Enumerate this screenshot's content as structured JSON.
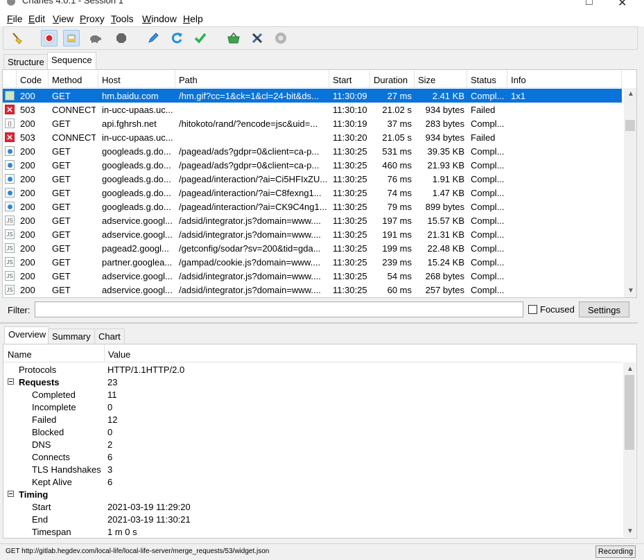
{
  "window": {
    "title": "Charles 4.0.1 - Session 1"
  },
  "menu": [
    {
      "key": "F",
      "rest": "ile"
    },
    {
      "key": "E",
      "rest": "dit"
    },
    {
      "key": "V",
      "rest": "iew"
    },
    {
      "key": "P",
      "rest": "roxy"
    },
    {
      "key": "T",
      "rest": "ools"
    },
    {
      "key": "W",
      "rest": "indow"
    },
    {
      "key": "H",
      "rest": "elp"
    }
  ],
  "toolbar_icons": [
    "broom-icon",
    "record-icon",
    "throttle-icon",
    "turtle-icon",
    "stop-icon",
    "pen-icon",
    "refresh-icon",
    "check-icon",
    "basket-icon",
    "tools-icon",
    "gear-icon"
  ],
  "view_tabs": [
    "Structure",
    "Sequence"
  ],
  "columns": [
    "Code",
    "Method",
    "Host",
    "Path",
    "Start",
    "Duration",
    "Size",
    "Status",
    "Info"
  ],
  "rows": [
    {
      "icon": "image",
      "code": "200",
      "method": "GET",
      "host": "hm.baidu.com",
      "path": "/hm.gif?cc=1&ck=1&cl=24-bit&ds...",
      "start": "11:30:09",
      "duration": "27 ms",
      "size": "2.41 KB",
      "status": "Compl...",
      "info": "1x1",
      "selected": true
    },
    {
      "icon": "error",
      "code": "503",
      "method": "CONNECT",
      "host": "in-ucc-upaas.uc...",
      "path": "",
      "start": "11:30:10",
      "duration": "21.02 s",
      "size": "934 bytes",
      "status": "Failed",
      "info": ""
    },
    {
      "icon": "file",
      "code": "200",
      "method": "GET",
      "host": "api.fghrsh.net",
      "path": "/hitokoto/rand/?encode=jsc&uid=...",
      "start": "11:30:19",
      "duration": "37 ms",
      "size": "283 bytes",
      "status": "Compl...",
      "info": ""
    },
    {
      "icon": "error",
      "code": "503",
      "method": "CONNECT",
      "host": "in-ucc-upaas.uc...",
      "path": "",
      "start": "11:30:20",
      "duration": "21.05 s",
      "size": "934 bytes",
      "status": "Failed",
      "info": ""
    },
    {
      "icon": "dot",
      "code": "200",
      "method": "GET",
      "host": "googleads.g.do...",
      "path": "/pagead/ads?gdpr=0&client=ca-p...",
      "start": "11:30:25",
      "duration": "531 ms",
      "size": "39.35 KB",
      "status": "Compl...",
      "info": ""
    },
    {
      "icon": "dot",
      "code": "200",
      "method": "GET",
      "host": "googleads.g.do...",
      "path": "/pagead/ads?gdpr=0&client=ca-p...",
      "start": "11:30:25",
      "duration": "460 ms",
      "size": "21.93 KB",
      "status": "Compl...",
      "info": ""
    },
    {
      "icon": "dot",
      "code": "200",
      "method": "GET",
      "host": "googleads.g.do...",
      "path": "/pagead/interaction/?ai=Ci5HFIxZU...",
      "start": "11:30:25",
      "duration": "76 ms",
      "size": "1.91 KB",
      "status": "Compl...",
      "info": ""
    },
    {
      "icon": "dot",
      "code": "200",
      "method": "GET",
      "host": "googleads.g.do...",
      "path": "/pagead/interaction/?ai=C8fexng1...",
      "start": "11:30:25",
      "duration": "74 ms",
      "size": "1.47 KB",
      "status": "Compl...",
      "info": ""
    },
    {
      "icon": "dot",
      "code": "200",
      "method": "GET",
      "host": "googleads.g.do...",
      "path": "/pagead/interaction/?ai=CK9C4ng1...",
      "start": "11:30:25",
      "duration": "79 ms",
      "size": "899 bytes",
      "status": "Compl...",
      "info": ""
    },
    {
      "icon": "js",
      "code": "200",
      "method": "GET",
      "host": "adservice.googl...",
      "path": "/adsid/integrator.js?domain=www....",
      "start": "11:30:25",
      "duration": "197 ms",
      "size": "15.57 KB",
      "status": "Compl...",
      "info": ""
    },
    {
      "icon": "js",
      "code": "200",
      "method": "GET",
      "host": "adservice.googl...",
      "path": "/adsid/integrator.js?domain=www....",
      "start": "11:30:25",
      "duration": "191 ms",
      "size": "21.31 KB",
      "status": "Compl...",
      "info": ""
    },
    {
      "icon": "js",
      "code": "200",
      "method": "GET",
      "host": "pagead2.googl...",
      "path": "/getconfig/sodar?sv=200&tid=gda...",
      "start": "11:30:25",
      "duration": "199 ms",
      "size": "22.48 KB",
      "status": "Compl...",
      "info": ""
    },
    {
      "icon": "js",
      "code": "200",
      "method": "GET",
      "host": "partner.googlea...",
      "path": "/gampad/cookie.js?domain=www....",
      "start": "11:30:25",
      "duration": "239 ms",
      "size": "15.24 KB",
      "status": "Compl...",
      "info": ""
    },
    {
      "icon": "js",
      "code": "200",
      "method": "GET",
      "host": "adservice.googl...",
      "path": "/adsid/integrator.js?domain=www....",
      "start": "11:30:25",
      "duration": "54 ms",
      "size": "268 bytes",
      "status": "Compl...",
      "info": ""
    },
    {
      "icon": "js",
      "code": "200",
      "method": "GET",
      "host": "adservice.googl...",
      "path": "/adsid/integrator.js?domain=www....",
      "start": "11:30:25",
      "duration": "60 ms",
      "size": "257 bytes",
      "status": "Compl...",
      "info": ""
    }
  ],
  "filter": {
    "label": "Filter:",
    "value": "",
    "focused_label": "Focused",
    "focused_checked": false,
    "settings_label": "Settings"
  },
  "detail_tabs": [
    "Overview",
    "Summary",
    "Chart"
  ],
  "overview": {
    "col_name": "Name",
    "col_value": "Value",
    "rows": [
      {
        "name": "Protocols",
        "value": "HTTP/1.1HTTP/2.0",
        "level": 0,
        "group": false
      },
      {
        "name": "Requests",
        "value": "23",
        "level": 0,
        "group": true
      },
      {
        "name": "Completed",
        "value": "11",
        "level": 1,
        "group": false
      },
      {
        "name": "Incomplete",
        "value": "0",
        "level": 1,
        "group": false
      },
      {
        "name": "Failed",
        "value": "12",
        "level": 1,
        "group": false
      },
      {
        "name": "Blocked",
        "value": "0",
        "level": 1,
        "group": false
      },
      {
        "name": "DNS",
        "value": "2",
        "level": 1,
        "group": false
      },
      {
        "name": "Connects",
        "value": "6",
        "level": 1,
        "group": false
      },
      {
        "name": "TLS Handshakes",
        "value": "3",
        "level": 1,
        "group": false
      },
      {
        "name": "Kept Alive",
        "value": "6",
        "level": 1,
        "group": false
      },
      {
        "name": "Timing",
        "value": "",
        "level": 0,
        "group": true
      },
      {
        "name": "Start",
        "value": "2021-03-19 11:29:20",
        "level": 1,
        "group": false
      },
      {
        "name": "End",
        "value": "2021-03-19 11:30:21",
        "level": 1,
        "group": false
      },
      {
        "name": "Timespan",
        "value": "1 m 0 s",
        "level": 1,
        "group": false
      }
    ]
  },
  "status": {
    "text": "GET http://gitlab.hegdev.com/local-life/local-life-server/merge_requests/53/widget.json",
    "recording": "Recording"
  },
  "colors": {
    "selection": "#0a73d9",
    "error": "#e32636",
    "accent_check": "#29b24a",
    "accent_refresh": "#1e8fe1"
  }
}
